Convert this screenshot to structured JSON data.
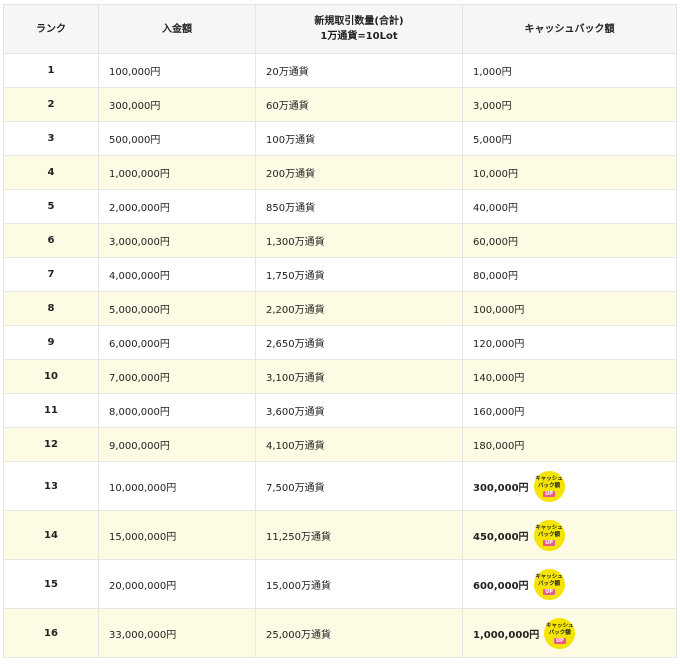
{
  "table": {
    "headers": {
      "rank": "ランク",
      "deposit": "入金額",
      "volume_line1": "新規取引数量(合計)",
      "volume_line2": "1万通貨=10Lot",
      "cashback": "キャッシュバック額"
    },
    "rows": [
      {
        "rank": "1",
        "deposit": "100,000円",
        "volume": "20万通貨",
        "cashback": "1,000円"
      },
      {
        "rank": "2",
        "deposit": "300,000円",
        "volume": "60万通貨",
        "cashback": "3,000円"
      },
      {
        "rank": "3",
        "deposit": "500,000円",
        "volume": "100万通貨",
        "cashback": "5,000円"
      },
      {
        "rank": "4",
        "deposit": "1,000,000円",
        "volume": "200万通貨",
        "cashback": "10,000円"
      },
      {
        "rank": "5",
        "deposit": "2,000,000円",
        "volume": "850万通貨",
        "cashback": "40,000円"
      },
      {
        "rank": "6",
        "deposit": "3,000,000円",
        "volume": "1,300万通貨",
        "cashback": "60,000円"
      },
      {
        "rank": "7",
        "deposit": "4,000,000円",
        "volume": "1,750万通貨",
        "cashback": "80,000円"
      },
      {
        "rank": "8",
        "deposit": "5,000,000円",
        "volume": "2,200万通貨",
        "cashback": "100,000円"
      },
      {
        "rank": "9",
        "deposit": "6,000,000円",
        "volume": "2,650万通貨",
        "cashback": "120,000円"
      },
      {
        "rank": "10",
        "deposit": "7,000,000円",
        "volume": "3,100万通貨",
        "cashback": "140,000円"
      },
      {
        "rank": "11",
        "deposit": "8,000,000円",
        "volume": "3,600万通貨",
        "cashback": "160,000円"
      },
      {
        "rank": "12",
        "deposit": "9,000,000円",
        "volume": "4,100万通貨",
        "cashback": "180,000円"
      },
      {
        "rank": "13",
        "deposit": "10,000,000円",
        "volume": "7,500万通貨",
        "cashback": "300,000円",
        "badge": true
      },
      {
        "rank": "14",
        "deposit": "15,000,000円",
        "volume": "11,250万通貨",
        "cashback": "450,000円",
        "badge": true
      },
      {
        "rank": "15",
        "deposit": "20,000,000円",
        "volume": "15,000万通貨",
        "cashback": "600,000円",
        "badge": true
      },
      {
        "rank": "16",
        "deposit": "33,000,000円",
        "volume": "25,000万通貨",
        "cashback": "1,000,000円",
        "badge": true
      }
    ],
    "badge": {
      "line1": "キャッシュ",
      "line2": "バック額",
      "up": "UP",
      "icon": "cashback-up-badge-icon",
      "color": "#f5e400",
      "up_color": "#e85a8c"
    },
    "colors": {
      "header_bg": "#f4f6f8",
      "row_odd": "#ffffff",
      "row_even": "#fdfbe3"
    }
  }
}
